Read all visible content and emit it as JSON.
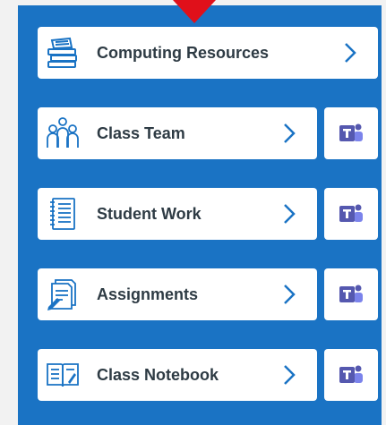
{
  "panel": {
    "background": "#1a73c4"
  },
  "items": [
    {
      "label": "Computing Resources",
      "icon": "books-icon",
      "teams": false
    },
    {
      "label": "Class Team",
      "icon": "people-icon",
      "teams": true
    },
    {
      "label": "Student Work",
      "icon": "notebook-icon",
      "teams": true
    },
    {
      "label": "Assignments",
      "icon": "assignment-icon",
      "teams": true
    },
    {
      "label": "Class Notebook",
      "icon": "open-book-icon",
      "teams": true
    }
  ],
  "colors": {
    "icon_blue": "#1a73c4",
    "teams_purple": "#5558af",
    "marker_red": "#e0101a"
  }
}
